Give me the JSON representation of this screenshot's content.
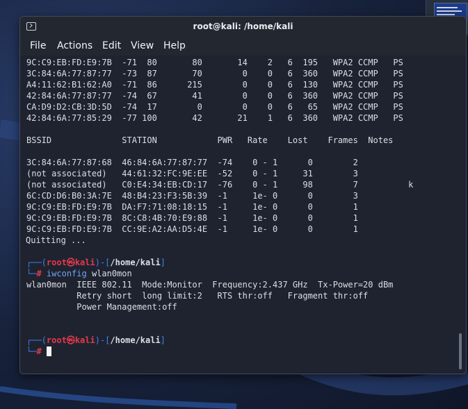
{
  "window": {
    "title": "root@kali: /home/kali"
  },
  "menu": [
    "File",
    "Actions",
    "Edit",
    "View",
    "Help"
  ],
  "ap_rows": [
    "9C:C9:EB:FD:E9:7B  -71  80       80       14    2   6  195   WPA2 CCMP   PS",
    "3C:84:6A:77:87:77  -73  87       70        0    0   6  360   WPA2 CCMP   PS",
    "A4:11:62:B1:62:A0  -71  86      215        0    0   6  130   WPA2 CCMP   PS",
    "42:84:6A:77:87:77  -74  67       41        0    0   6  360   WPA2 CCMP   PS",
    "CA:D9:D2:CB:3D:5D  -74  17        0        0    0   6   65   WPA2 CCMP   PS",
    "42:84:6A:77:85:29  -77 100       42       21    1   6  360   WPA2 CCMP   PS"
  ],
  "station_header": "BSSID              STATION            PWR   Rate    Lost    Frames  Notes",
  "station_rows": [
    "3C:84:6A:77:87:68  46:84:6A:77:87:77  -74    0 - 1      0        2",
    "(not associated)   44:61:32:FC:9E:EE  -52    0 - 1     31        3",
    "(not associated)   C0:E4:34:EB:CD:17  -76    0 - 1     98        7          k",
    "6C:CD:D6:B0:3A:7E  48:B4:23:F3:5B:39  -1     1e- 0      0        3",
    "9C:C9:EB:FD:E9:7B  DA:F7:71:08:18:15  -1     1e- 0      0        1",
    "9C:C9:EB:FD:E9:7B  8C:C8:4B:70:E9:88  -1     1e- 0      0        1",
    "9C:C9:EB:FD:E9:7B  CC:9E:A2:AA:D5:4E  -1     1e- 0      0        1"
  ],
  "quitting": "Quitting ...",
  "prompt": {
    "open": "┌──(",
    "user": "root",
    "at": "㉿",
    "host": "kali",
    "mid": ")-[",
    "path": "/home/kali",
    "close": "]",
    "line2_prefix": "└─",
    "hash": "#"
  },
  "command": {
    "name": "iwconfig",
    "arg": " wlan0mon"
  },
  "iwconfig_output": [
    "wlan0mon  IEEE 802.11  Mode:Monitor  Frequency:2.437 GHz  Tx-Power=20 dBm",
    "          Retry short  long limit:2   RTS thr:off   Fragment thr:off",
    "          Power Management:off"
  ]
}
